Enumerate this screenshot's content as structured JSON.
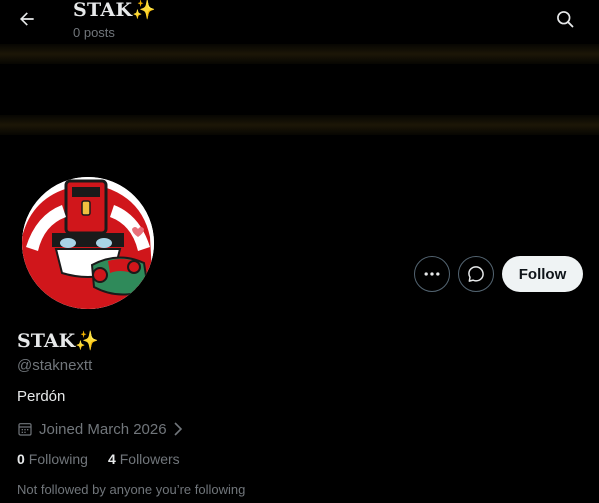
{
  "header": {
    "title": "STAK✨",
    "post_count": "0 posts",
    "back_icon": "arrow-left-icon",
    "search_icon": "search-icon"
  },
  "profile": {
    "display_name": "STAK✨",
    "handle": "@staknextt",
    "bio": "Perdón",
    "joined": "Joined March 2026",
    "following_count": "0",
    "following_label": "Following",
    "followers_count": "4",
    "followers_label": "Followers",
    "not_followed_text": "Not followed by anyone you’re following"
  },
  "actions": {
    "more_icon": "more-dots-icon",
    "message_icon": "message-icon",
    "follow_label": "Follow"
  },
  "colors": {
    "background": "#000000",
    "primary_text": "#e7e9ea",
    "secondary_text": "#71767b",
    "button_border": "#536471",
    "follow_bg": "#eff3f4",
    "banner_stripe": "#1c1607"
  }
}
